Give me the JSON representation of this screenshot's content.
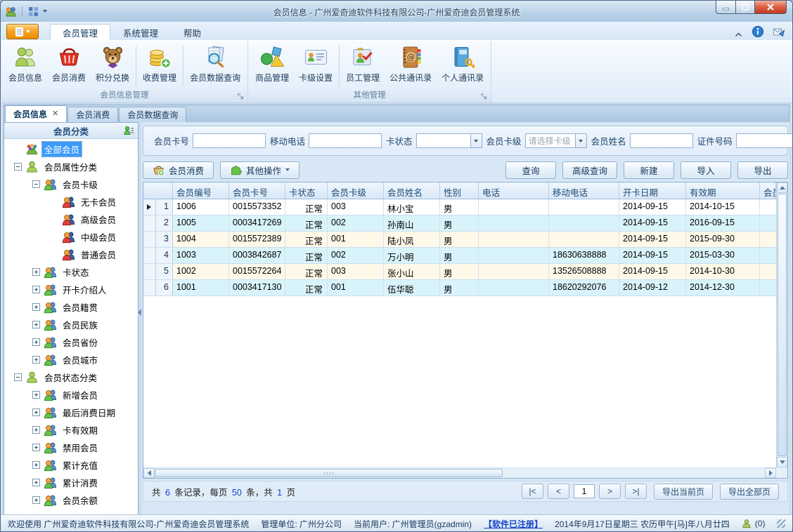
{
  "titlebar": {
    "title": "会员信息 - 广州爱奇迪软件科技有限公司-广州爱奇迪会员管理系统"
  },
  "ribbon": {
    "tabs": [
      {
        "label": "会员管理",
        "active": true
      },
      {
        "label": "系统管理",
        "active": false
      },
      {
        "label": "帮助",
        "active": false
      }
    ],
    "groups": [
      {
        "label": "会员信息管理",
        "buttons": [
          {
            "label": "会员信息",
            "icon": "members-icon"
          },
          {
            "label": "会员消费",
            "icon": "basket-icon"
          },
          {
            "label": "积分兑换",
            "icon": "teddy-icon"
          },
          {
            "label": "收费管理",
            "icon": "coins-icon"
          },
          {
            "label": "会员数据查询",
            "icon": "data-query-icon"
          }
        ]
      },
      {
        "label": "其他管理",
        "buttons": [
          {
            "label": "商品管理",
            "icon": "goods-icon"
          },
          {
            "label": "卡级设置",
            "icon": "card-level-icon"
          },
          {
            "label": "员工管理",
            "icon": "staff-icon"
          },
          {
            "label": "公共通讯录",
            "icon": "public-contacts-icon"
          },
          {
            "label": "个人通讯录",
            "icon": "personal-contacts-icon"
          }
        ]
      }
    ]
  },
  "doc_tabs": [
    {
      "label": "会员信息",
      "active": true,
      "closable": true
    },
    {
      "label": "会员消费",
      "active": false,
      "closable": false
    },
    {
      "label": "会员数据查询",
      "active": false,
      "closable": false
    }
  ],
  "tree": {
    "header": "会员分类",
    "items": [
      {
        "label": "全部会员",
        "level": 0,
        "icon": "all-members-icon",
        "expander": "none",
        "selected": true
      },
      {
        "label": "会员属性分类",
        "level": 0,
        "icon": "person-green-icon",
        "expander": "minus"
      },
      {
        "label": "会员卡级",
        "level": 1,
        "icon": "duo-green-icon",
        "expander": "minus"
      },
      {
        "label": "无卡会员",
        "level": 2,
        "icon": "duo-red-icon",
        "expander": "none"
      },
      {
        "label": "高级会员",
        "level": 2,
        "icon": "duo-red-icon",
        "expander": "none"
      },
      {
        "label": "中级会员",
        "level": 2,
        "icon": "duo-red-icon",
        "expander": "none"
      },
      {
        "label": "普通会员",
        "level": 2,
        "icon": "duo-red-icon",
        "expander": "none"
      },
      {
        "label": "卡状态",
        "level": 1,
        "icon": "duo-green-icon",
        "expander": "plus"
      },
      {
        "label": "开卡介绍人",
        "level": 1,
        "icon": "duo-green-icon",
        "expander": "plus"
      },
      {
        "label": "会员籍贯",
        "level": 1,
        "icon": "duo-green-icon",
        "expander": "plus"
      },
      {
        "label": "会员民族",
        "level": 1,
        "icon": "duo-green-icon",
        "expander": "plus"
      },
      {
        "label": "会员省份",
        "level": 1,
        "icon": "duo-green-icon",
        "expander": "plus"
      },
      {
        "label": "会员城市",
        "level": 1,
        "icon": "duo-green-icon",
        "expander": "plus"
      },
      {
        "label": "会员状态分类",
        "level": 0,
        "icon": "person-green-icon",
        "expander": "minus"
      },
      {
        "label": "新增会员",
        "level": 1,
        "icon": "duo-green-icon",
        "expander": "plus"
      },
      {
        "label": "最后消费日期",
        "level": 1,
        "icon": "duo-green-icon",
        "expander": "plus"
      },
      {
        "label": "卡有效期",
        "level": 1,
        "icon": "duo-green-icon",
        "expander": "plus"
      },
      {
        "label": "禁用会员",
        "level": 1,
        "icon": "duo-green-icon",
        "expander": "plus"
      },
      {
        "label": "累计充值",
        "level": 1,
        "icon": "duo-green-icon",
        "expander": "plus"
      },
      {
        "label": "累计消费",
        "level": 1,
        "icon": "duo-green-icon",
        "expander": "plus"
      },
      {
        "label": "会员余额",
        "level": 1,
        "icon": "duo-green-icon",
        "expander": "plus"
      }
    ]
  },
  "filters": [
    {
      "label": "会员卡号",
      "type": "input",
      "value": ""
    },
    {
      "label": "移动电话",
      "type": "input",
      "value": ""
    },
    {
      "label": "卡状态",
      "type": "combo",
      "value": "",
      "placeholder": ""
    },
    {
      "label": "会员卡级",
      "type": "combo",
      "value": "",
      "placeholder": "请选择卡级"
    },
    {
      "label": "会员姓名",
      "type": "input",
      "value": ""
    },
    {
      "label": "证件号码",
      "type": "input",
      "value": ""
    }
  ],
  "toolbar": {
    "left": [
      {
        "label": "会员消费",
        "icon": "basket-add-icon",
        "dropdown": false
      },
      {
        "label": "其他操作",
        "icon": "puzzle-icon",
        "dropdown": true
      }
    ],
    "right": [
      {
        "label": "查询"
      },
      {
        "label": "高级查询"
      },
      {
        "label": "新建"
      },
      {
        "label": "导入"
      },
      {
        "label": "导出"
      }
    ]
  },
  "table": {
    "columns": [
      "会员编号",
      "会员卡号",
      "卡状态",
      "会员卡级",
      "会员姓名",
      "性别",
      "电话",
      "移动电话",
      "开卡日期",
      "有效期",
      "会员"
    ],
    "rows": [
      {
        "num": "1",
        "current": true,
        "cells": [
          "1006",
          "0015573352",
          "正常",
          "003",
          "林小宝",
          "男",
          "",
          "",
          "2014-09-15",
          "2014-10-15",
          ""
        ]
      },
      {
        "num": "2",
        "current": false,
        "cells": [
          "1005",
          "0003417269",
          "正常",
          "002",
          "孙南山",
          "男",
          "",
          "",
          "2014-09-15",
          "2016-09-15",
          ""
        ]
      },
      {
        "num": "3",
        "current": false,
        "cells": [
          "1004",
          "0015572389",
          "正常",
          "001",
          "陆小凤",
          "男",
          "",
          "",
          "2014-09-15",
          "2015-09-30",
          ""
        ]
      },
      {
        "num": "4",
        "current": false,
        "cells": [
          "1003",
          "0003842687",
          "正常",
          "002",
          "万小明",
          "男",
          "",
          "18630638888",
          "2014-09-15",
          "2015-03-30",
          ""
        ]
      },
      {
        "num": "5",
        "current": false,
        "cells": [
          "1002",
          "0015572264",
          "正常",
          "003",
          "张小山",
          "男",
          "",
          "13526508888",
          "2014-09-15",
          "2014-10-30",
          ""
        ]
      },
      {
        "num": "6",
        "current": false,
        "cells": [
          "1001",
          "0003417130",
          "正常",
          "001",
          "伍华聪",
          "男",
          "",
          "18620292076",
          "2014-09-12",
          "2014-12-30",
          ""
        ]
      }
    ]
  },
  "pagination": {
    "summary_prefix": "共 ",
    "total_records": "6",
    "summary_mid1": " 条记录，每页 ",
    "per_page": "50",
    "summary_mid2": " 条，共 ",
    "total_pages": "1",
    "summary_suffix": " 页",
    "first": "|<",
    "prev": "<",
    "page": "1",
    "next": ">",
    "last": ">|",
    "export_current": "导出当前页",
    "export_all": "导出全部页"
  },
  "statusbar": {
    "welcome": "欢迎使用 广州爱奇迪软件科技有限公司-广州爱奇迪会员管理系统",
    "unit": "管理单位: 广州分公司",
    "user": "当前用户: 广州管理员(gzadmin)",
    "registered": "【软件已注册】",
    "date": "2014年9月17日星期三 农历甲午[马]年八月廿四",
    "online_count": "(0)"
  }
}
